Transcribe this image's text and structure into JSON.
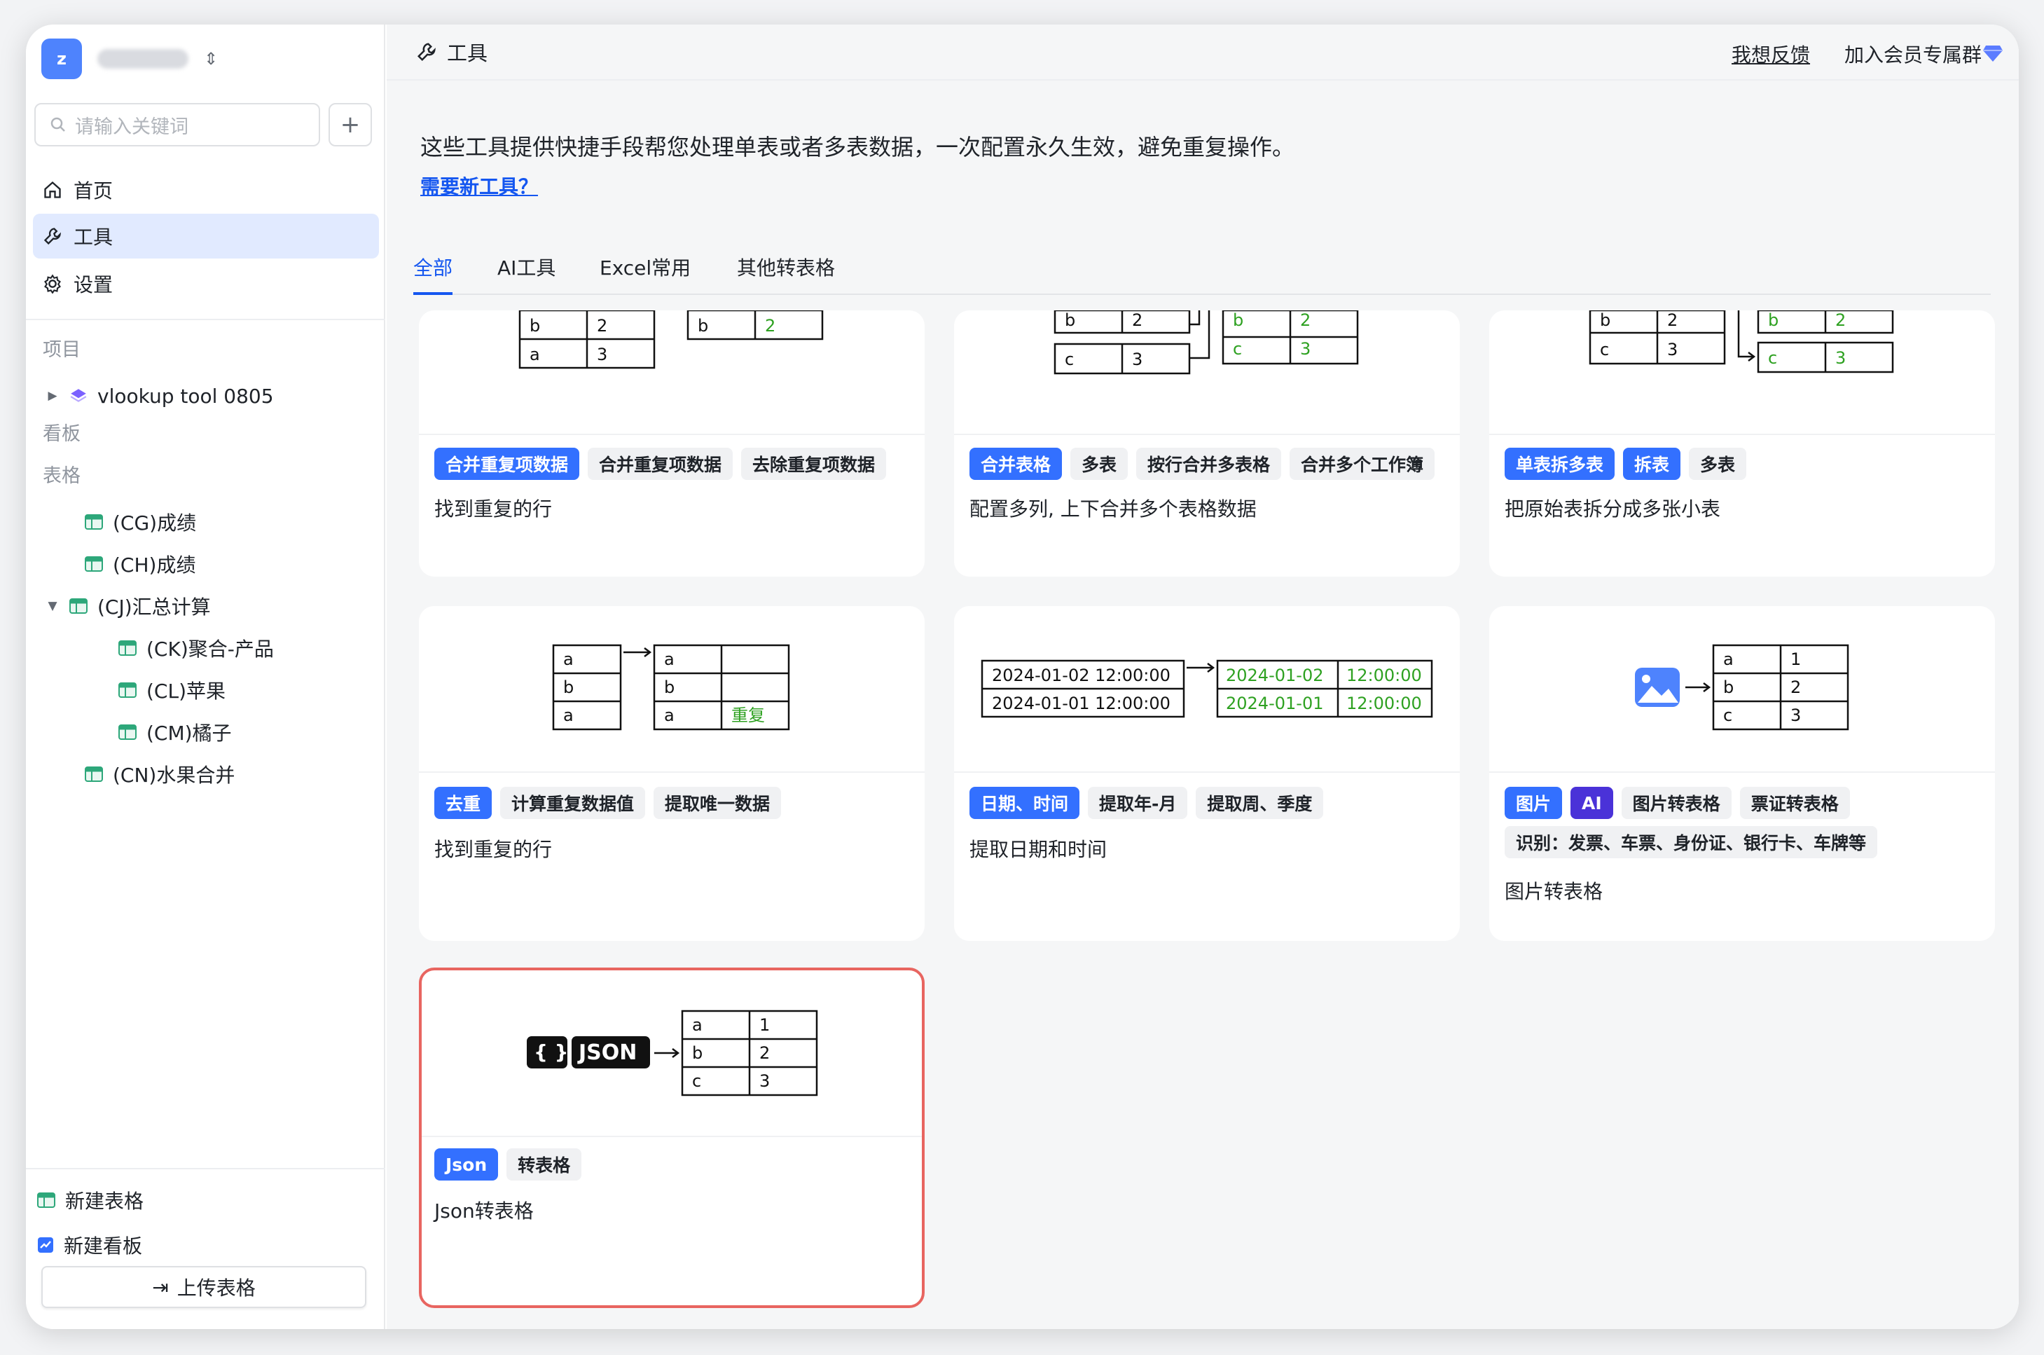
{
  "workspace": {
    "avatar_letter": "z"
  },
  "search": {
    "placeholder": "请输入关键词"
  },
  "nav": {
    "home": "首页",
    "tools": "工具",
    "settings": "设置"
  },
  "sections": {
    "projects": "项目",
    "boards": "看板",
    "tables": "表格"
  },
  "project": {
    "name": "vlookup tool 0805"
  },
  "tables": [
    "(CG)成绩",
    "(CH)成绩",
    "(CJ)汇总计算",
    "(CK)聚合-产品",
    "(CL)苹果",
    "(CM)橘子",
    "(CN)水果合并"
  ],
  "bottom": {
    "new_table": "新建表格",
    "new_board": "新建看板",
    "upload": "上传表格"
  },
  "header": {
    "title": "工具",
    "feedback": "我想反馈",
    "join": "加入会员专属群"
  },
  "intro": {
    "description": "这些工具提供快捷手段帮您处理单表或者多表数据，一次配置永久生效，避免重复操作。",
    "need_link": "需要新工具？"
  },
  "tabs": [
    "全部",
    "AI工具",
    "Excel常用",
    "其他转表格"
  ],
  "cards": [
    {
      "tags": [
        "合并重复项数据",
        "合并重复项数据",
        "去除重复项数据"
      ],
      "desc": "找到重复的行"
    },
    {
      "tags": [
        "合并表格",
        "多表",
        "按行合并多表格",
        "合并多个工作簿"
      ],
      "desc": "配置多列, 上下合并多个表格数据"
    },
    {
      "tags": [
        "单表拆多表",
        "拆表",
        "多表"
      ],
      "desc": "把原始表拆分成多张小表"
    },
    {
      "tags": [
        "去重",
        "计算重复数据值",
        "提取唯一数据"
      ],
      "desc": "找到重复的行"
    },
    {
      "tags": [
        "日期、时间",
        "提取年-月",
        "提取周、季度"
      ],
      "desc": "提取日期和时间"
    },
    {
      "tags": [
        "图片",
        "AI",
        "图片转表格",
        "票证转表格"
      ],
      "tags2": [
        "识别：发票、车票、身份证、银行卡、车牌等"
      ],
      "desc": "图片转表格"
    },
    {
      "tags": [
        "Json",
        "转表格"
      ],
      "desc": "Json转表格"
    }
  ],
  "illus": {
    "c1": {
      "r1": [
        "b",
        "2"
      ],
      "r2": [
        "a",
        "3"
      ],
      "out": [
        "b",
        "2"
      ]
    },
    "c2": {
      "a": [
        "b",
        "2"
      ],
      "b": [
        "c",
        "3"
      ],
      "out1": [
        "b",
        "2"
      ],
      "out2": [
        "c",
        "3"
      ]
    },
    "c3": {
      "r1": [
        "b",
        "2"
      ],
      "r2": [
        "c",
        "3"
      ],
      "out1": [
        "b",
        "2"
      ],
      "out2": [
        "c",
        "3"
      ]
    },
    "c4": {
      "left": [
        "a",
        "b",
        "a"
      ],
      "right": [
        "a",
        "b",
        "a"
      ],
      "dup": "重复"
    },
    "c5": {
      "in": [
        "2024-01-02 12:00:00",
        "2024-01-01 12:00:00"
      ],
      "d": [
        "2024-01-02",
        "2024-01-01"
      ],
      "t": [
        "12:00:00",
        "12:00:00"
      ]
    },
    "c6": {
      "k": [
        "a",
        "b",
        "c"
      ],
      "v": [
        "1",
        "2",
        "3"
      ]
    },
    "c7": {
      "badge": "JSON",
      "braces": "{ }",
      "k": [
        "a",
        "b",
        "c"
      ],
      "v": [
        "1",
        "2",
        "3"
      ]
    }
  },
  "colors": {
    "accent": "#3370ff",
    "green": "#2ea121",
    "selected_border": "#e86560"
  }
}
